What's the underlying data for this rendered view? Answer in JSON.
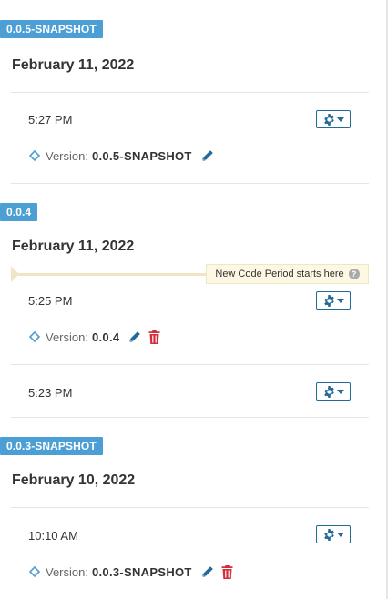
{
  "groups": [
    {
      "tag": "0.0.5-SNAPSHOT",
      "date": "February 11, 2022",
      "events": [
        {
          "time": "5:27 PM",
          "version_label": "Version:",
          "version_name": "0.0.5-SNAPSHOT",
          "actions": [
            "edit"
          ]
        }
      ]
    },
    {
      "tag": "0.0.4",
      "date": "February 11, 2022",
      "new_code_period": "New Code Period starts here",
      "events": [
        {
          "time": "5:25 PM",
          "version_label": "Version:",
          "version_name": "0.0.4",
          "actions": [
            "edit",
            "delete"
          ]
        },
        {
          "time": "5:23 PM"
        }
      ]
    },
    {
      "tag": "0.0.3-SNAPSHOT",
      "date": "February 10, 2022",
      "events": [
        {
          "time": "10:10 AM",
          "version_label": "Version:",
          "version_name": "0.0.3-SNAPSHOT",
          "actions": [
            "edit",
            "delete"
          ]
        }
      ]
    }
  ],
  "icons": {
    "gear": "gear-icon",
    "caret": "caret-down-icon",
    "version": "version-diamond-icon",
    "edit": "pencil-icon",
    "delete": "trash-icon",
    "help": "help-icon"
  },
  "help_glyph": "?",
  "colors": {
    "tag_bg": "#4b9fd5",
    "button_blue": "#236a97",
    "edit_blue": "#236a97",
    "delete_red": "#d02f3a",
    "ncp_bg": "#fcf8e3",
    "divider": "#e6e6e6"
  }
}
